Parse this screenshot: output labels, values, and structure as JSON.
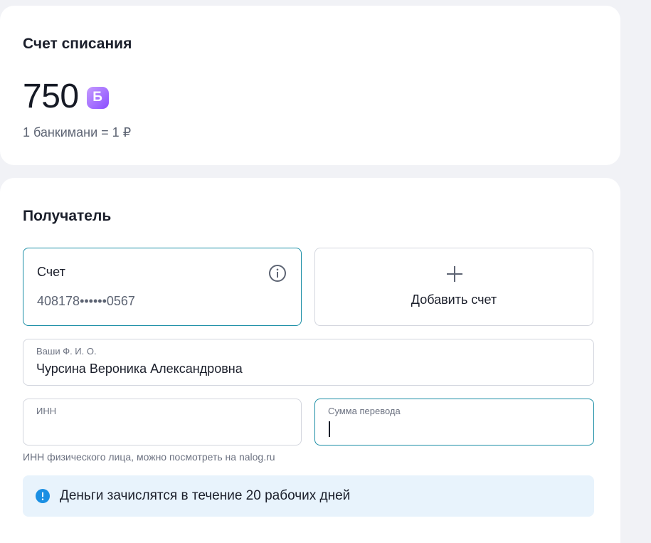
{
  "debit": {
    "title": "Счет списания",
    "amount": "750",
    "currency_symbol": "Б",
    "rate": "1 банкимани = 1 ₽"
  },
  "recipient": {
    "title": "Получатель",
    "account": {
      "label": "Счет",
      "number": "408178••••••0567",
      "info_icon": "info-icon"
    },
    "add_account": {
      "label": "Добавить счет",
      "icon": "plus-icon"
    },
    "fio_field": {
      "label": "Ваши Ф. И. О.",
      "value": "Чурсина Вероника Александровна"
    },
    "inn_field": {
      "label": "ИНН",
      "value": ""
    },
    "sum_field": {
      "label": "Сумма перевода",
      "value": ""
    },
    "inn_hint": "ИНН физического лица, можно посмотреть на nalog.ru",
    "notice": {
      "text": "Деньги зачислятся в течение 20 рабочих дней",
      "icon": "exclamation-icon"
    }
  },
  "colors": {
    "accent_border": "#1b8ea6",
    "notice_bg": "#e8f3fc",
    "notice_icon": "#1a8fe3",
    "coin_gradient_start": "#c59bff",
    "coin_gradient_end": "#8a4dff"
  }
}
